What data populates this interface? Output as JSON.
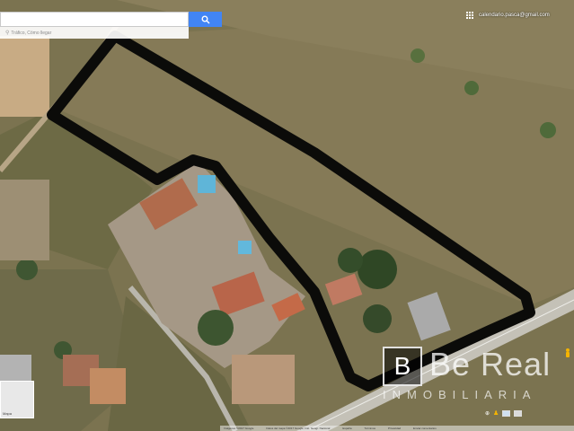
{
  "search": {
    "placeholder": "",
    "hint": "Tráfico, Cómo llegar",
    "button_icon": "search-icon",
    "button_color": "#4285f4"
  },
  "header": {
    "apps_icon": "apps-grid-icon",
    "account_email": "calendario.pasca@gmail.com"
  },
  "layer_thumb": {
    "label": "Mapa"
  },
  "attribution": {
    "items": [
      "Imágenes ©2017 Google",
      "Datos del mapa ©2017 Google, Inst. Geogr. Nacional",
      "España",
      "Términos",
      "Privacidad",
      "Enviar comentarios"
    ]
  },
  "watermark": {
    "letter": "B",
    "brand": "Be Real",
    "tagline": "INMOBILIARIA"
  },
  "colors": {
    "property_outline": "#0b0b09",
    "road": "#c2c0b8",
    "field": "#7e7553"
  }
}
